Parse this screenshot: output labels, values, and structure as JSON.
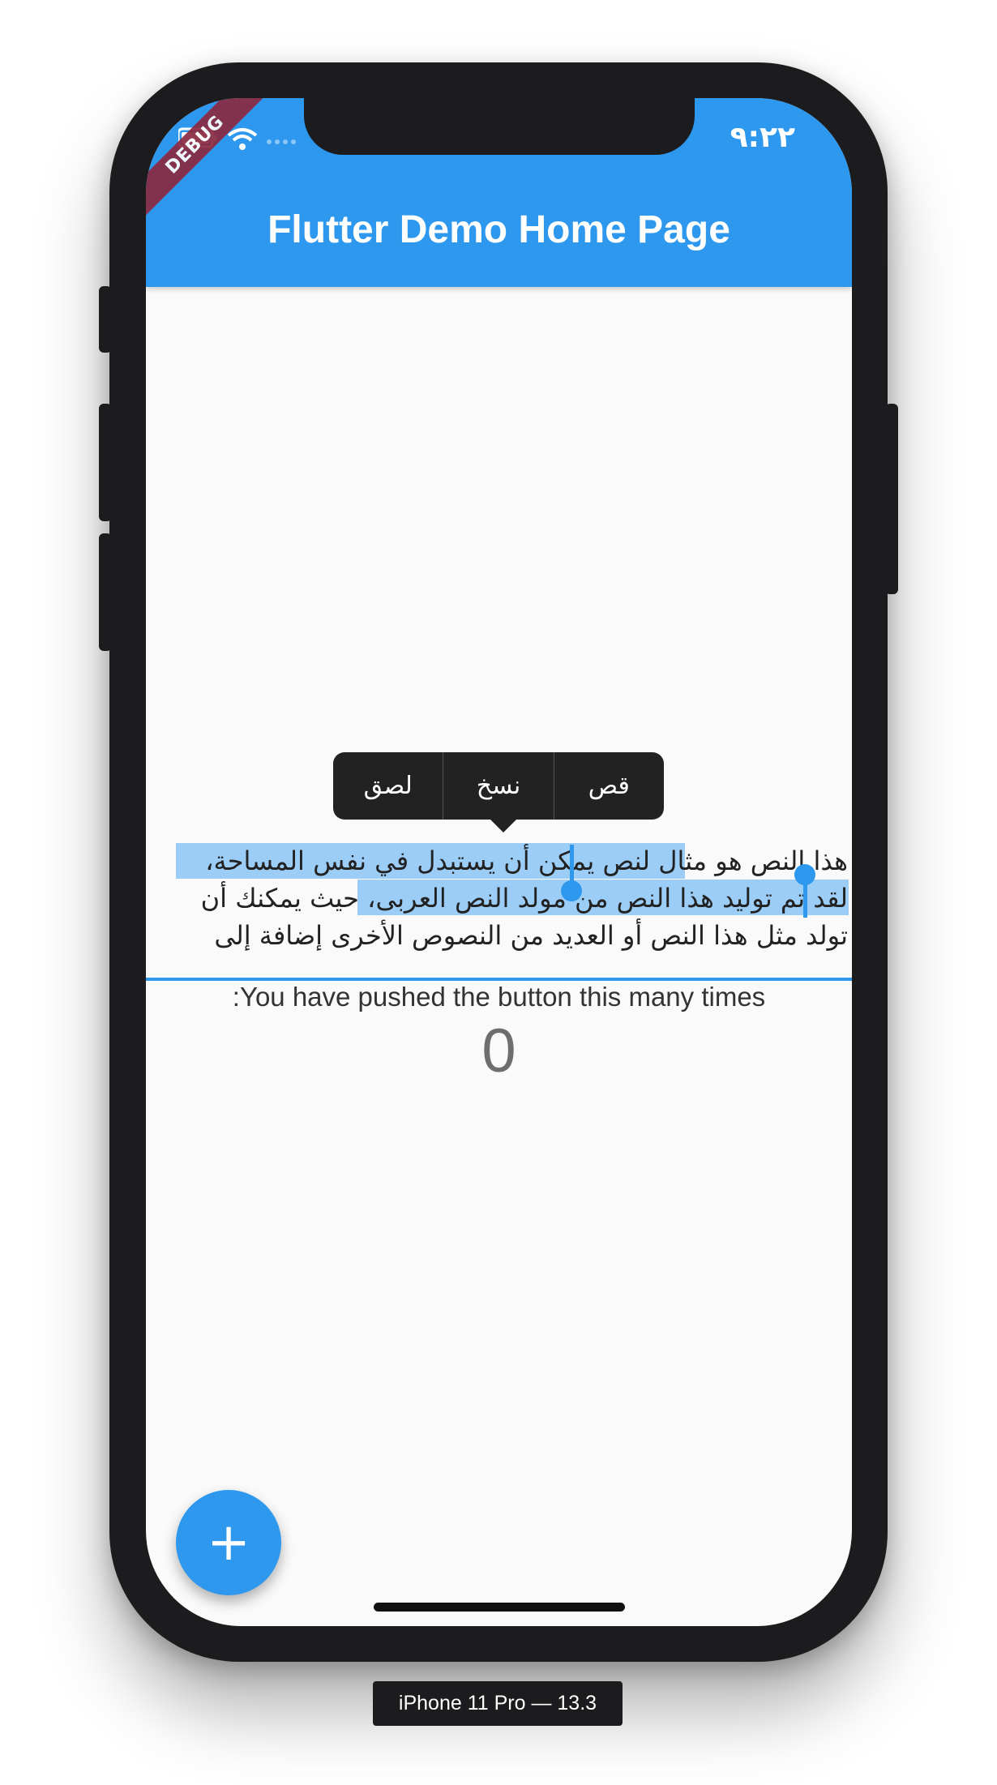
{
  "status_bar": {
    "time": "٩:٢٢",
    "debug_banner": "DEBUG"
  },
  "app_bar": {
    "title": "Flutter Demo Home Page"
  },
  "text_selection_toolbar": {
    "items": [
      "قص",
      "نسخ",
      "لصق"
    ]
  },
  "text_field": {
    "lines": [
      "هذا النص هو مثال لنص يمكن أن يستبدل في نفس المساحة،",
      "لقد تم توليد هذا النص من مولد النص العربى، حيث يمكنك أن",
      "تولد مثل هذا النص أو العديد من النصوص الأخرى إضافة إلى"
    ]
  },
  "counter": {
    "label": "You have pushed the button this many times:",
    "value": "0"
  },
  "fab": {
    "icon": "add-icon",
    "label": "+"
  },
  "device": {
    "label": "iPhone 11 Pro — 13.3"
  },
  "colors": {
    "primary": "#2d98ee",
    "selection": "#9ccdf7",
    "debug_banner": "#8b2a3f"
  }
}
